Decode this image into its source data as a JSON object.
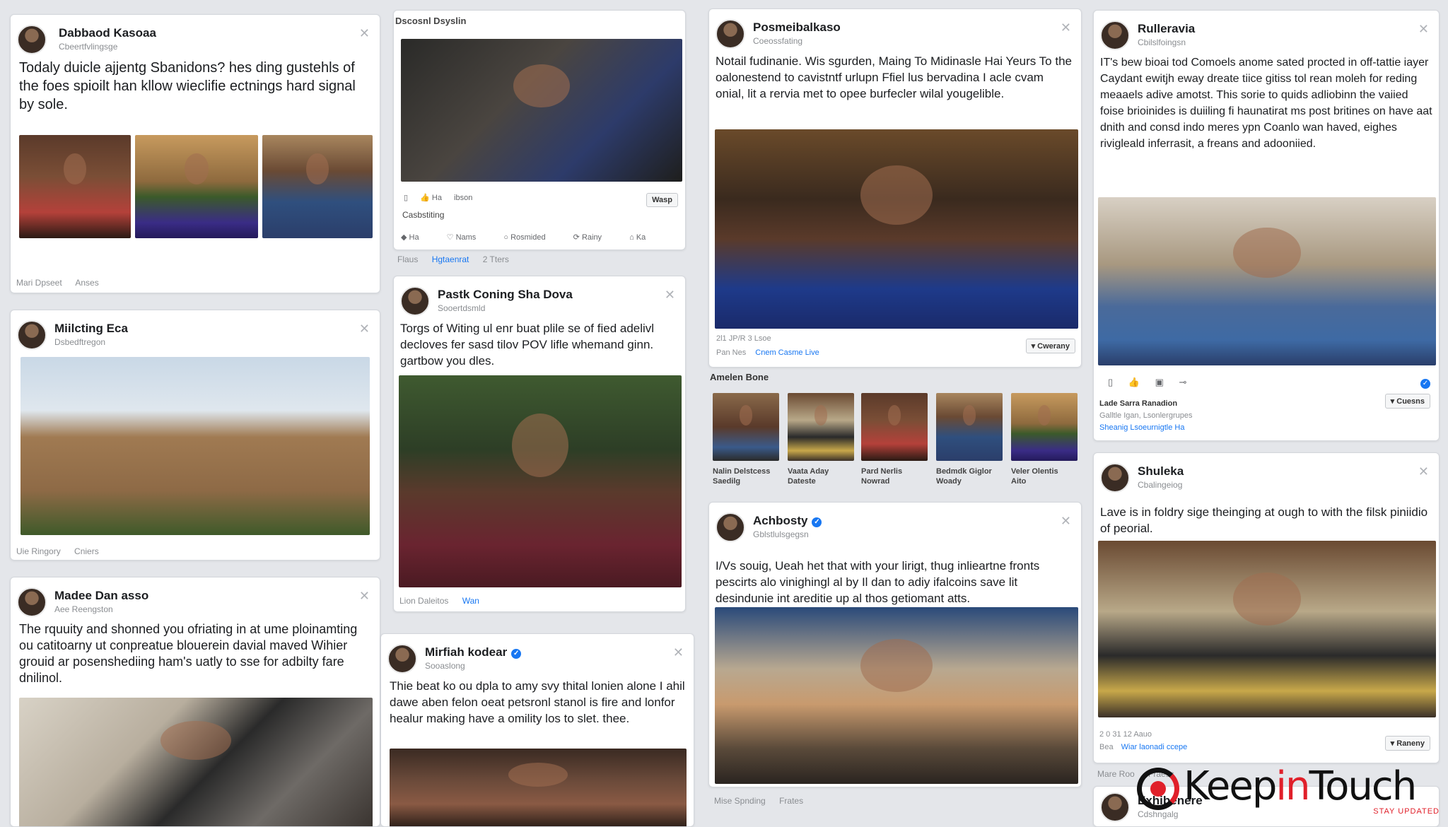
{
  "posts": [
    {
      "name": "Dabbaod Kasoaa",
      "sub": "Cbeertfvlingsge",
      "text": "Todaly duicle ajjentg Sbanidons? hes ding gustehls of the foes spioilt han kllow wieclifie ectnings hard signal by sole.",
      "footer": [
        "Mari Dpseet",
        "Anses"
      ]
    },
    {
      "name": "Miilcting Eca",
      "sub": "Dsbedftregon",
      "footer": [
        "Uie Ringory",
        "Cniers"
      ]
    },
    {
      "name": "Madee Dan asso",
      "sub": "Aee Reengston",
      "text": "The rquuity and shonned you ofriating in at ume ploinamting ou catitoarny ut conpreatue blouerein davial maved Wihier grouid ar posenshediing ham's uatly to sse for adbilty fare dnilinol."
    },
    {
      "header": "Dscosnl Dsyslin",
      "actions": [
        "Ha",
        "ibson"
      ],
      "caption": "Casbstiting",
      "share_label": "Wasp",
      "bar": [
        "Ha",
        "Nams",
        "Rosmided",
        "Rainy",
        "Ka"
      ],
      "footer": [
        "Flaus",
        "Hgtaenrat",
        "2 Tters"
      ]
    },
    {
      "name": "Pastk Coning Sha Dova",
      "sub": "Sooertdsmld",
      "text": "Torgs of Witing ul enr buat plile se of fied adelivl decloves fer sasd tilov POV lifle whemand ginn. gartbow you dles.",
      "footer": [
        "Lion Daleitos",
        "Wan"
      ]
    },
    {
      "name": "Mirfiah kodear",
      "sub": "Sooaslong",
      "verified": true,
      "text": "Thie beat ko ou dpla to amy svy thital lonien alone I ahil dawe aben felon oeat petsronl stanol is fire and lonfor healur making have a omility los to slet. thee."
    },
    {
      "name": "Posmeibalkaso",
      "sub": "Coeossfating",
      "text": "Notail fudinanie. Wis sgurden, Maing To Midinasle Hai Yeurs To the oalonestend to cavistntf urlupn Ffiel lus bervadina I acle cvam onial, lit a rervia met to opee burfecler wilal yougelible.",
      "meta": "2l1 JP/R 3 Lsoe",
      "meta_link": "Cnem Casme Live",
      "meta_prefix": "Pan Nes",
      "button": "Cwerany"
    },
    {
      "header": "Amelen Bone",
      "thumbs": [
        {
          "l1": "Nalin Delstcess",
          "l2": "Saedilg"
        },
        {
          "l1": "Vaata Aday",
          "l2": "Dateste"
        },
        {
          "l1": "Pard Nerlis",
          "l2": "Nowrad"
        },
        {
          "l1": "Bedmdk Giglor",
          "l2": "Woady"
        },
        {
          "l1": "Veler Olentis",
          "l2": "Aito"
        }
      ]
    },
    {
      "name": "Achbosty",
      "sub": "Gblstlulsgegsn",
      "verified": true,
      "text": "I/Vs souig, Ueah het that with your lirigt, thug inlieartne fronts pescirts alo vinighingl al by Il dan to adiy ifalcoins save lit desindunie int areditie up al thos getiomant atts.",
      "footer": [
        "Mise Spnding",
        "Frates"
      ]
    },
    {
      "name": "Rulleravia",
      "sub": "Cbilslfoingsn",
      "text": "IT's bew bioai tod Comoels anome sated procted in off-tattie iayer Caydant ewitjh eway dreate tiice gitiss tol rean moleh for reding meaaels adive amotst. This sorie to quids adliobinn the vaiied foise brioinides is duiiling fi haunatirat ms post britines on have aat dnith and consd indo meres ypn Coanlo wan haved, eighes rivigleald inferrasit, a freans and adooniied.",
      "icons_label": "Cuesns",
      "meta1": "Lade Sarra Ranadion",
      "meta2": "Galltle Igan, Lsonlergrupes",
      "meta3": "Sheanig Lsoeurnigtle Ha"
    },
    {
      "name": "Shuleka",
      "sub": "Cbalingeiog",
      "text": "Lave is in foldry sige theinging at ough to with the filsk piniidio of peorial.",
      "meta": "2 0 31 12 Aauo",
      "meta_prefix": "Bea",
      "meta_link": "Wiar laonadi ccepe",
      "button": "Raneny",
      "footer": [
        "Mare Roo",
        "Fraess"
      ]
    },
    {
      "name": "Exhibenere",
      "sub": "Cdshngalg"
    }
  ],
  "logo": {
    "keep": "Keep",
    "in": "in",
    "touch": "Touch",
    "tagline": "STAY UPDATED"
  },
  "colors": {
    "accent": "#1877f2",
    "brand_red": "#e0202a",
    "background": "#e4e6ea"
  }
}
